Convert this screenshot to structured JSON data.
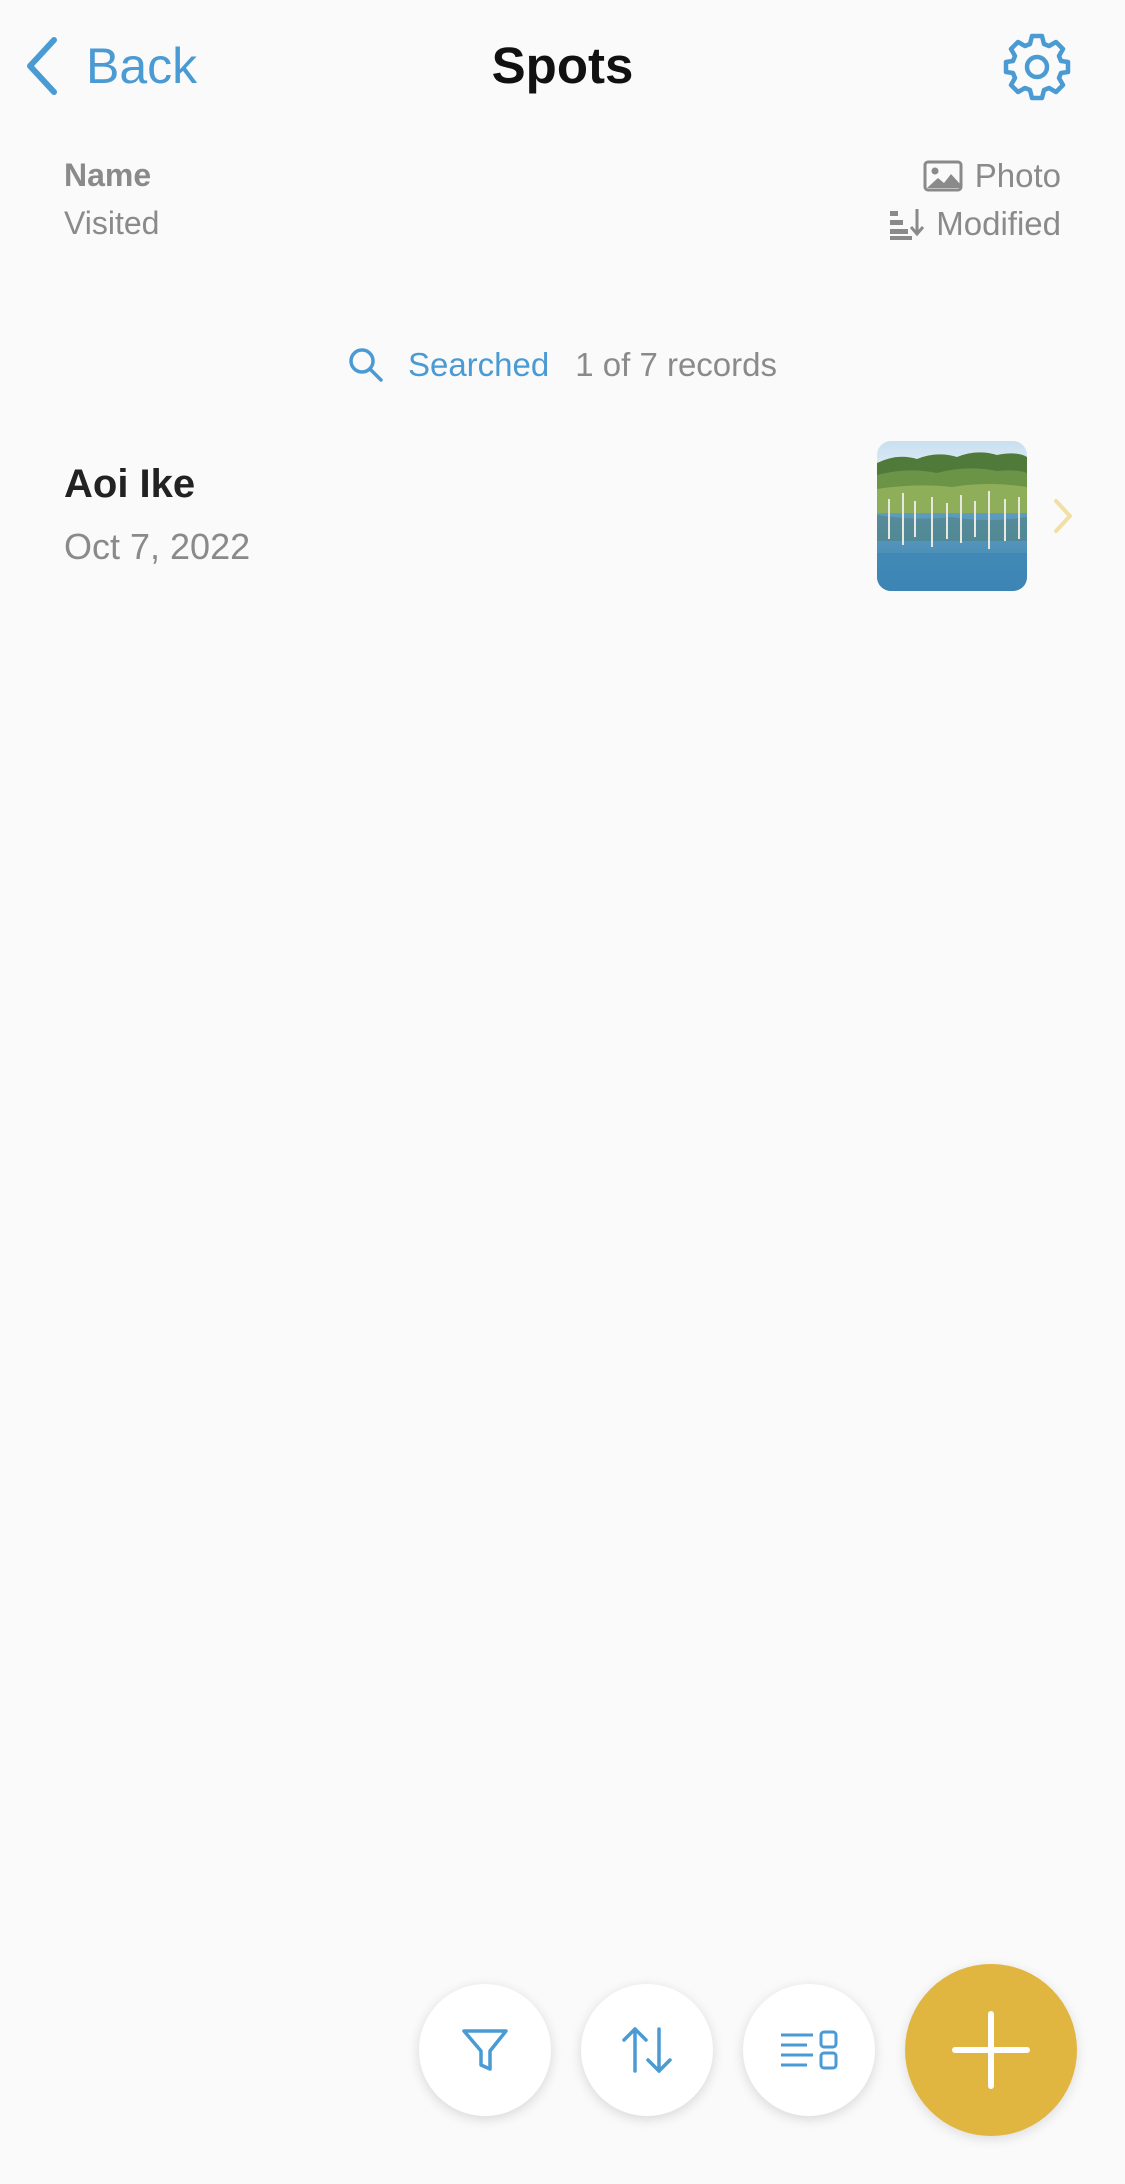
{
  "nav": {
    "back_label": "Back",
    "title": "Spots",
    "settings_icon": "gear-icon"
  },
  "fields": {
    "primary": "Name",
    "secondary": "Visited",
    "photo_label": "Photo",
    "sort_label": "Modified"
  },
  "search": {
    "status_label": "Searched",
    "count_text": "1 of 7 records"
  },
  "records": [
    {
      "name": "Aoi Ike",
      "date": "Oct 7, 2022"
    }
  ],
  "toolbar": {
    "filter_icon": "filter-icon",
    "sort_icon": "sort-icon",
    "layout_icon": "layout-icon",
    "add_icon": "plus-icon"
  },
  "colors": {
    "accent": "#4a9ad4",
    "add_button": "#e0b640",
    "secondary_text": "#8a8a8a",
    "chevron": "#f2dfa5",
    "background": "#fafafa"
  }
}
